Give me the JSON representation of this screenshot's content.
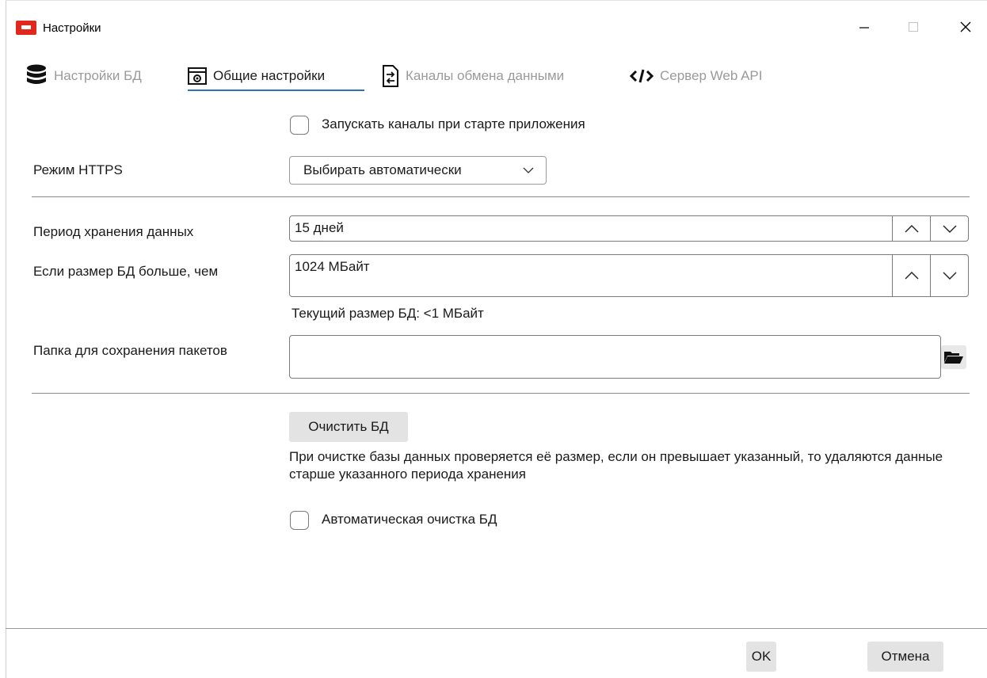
{
  "window": {
    "title": "Настройки"
  },
  "tabs": [
    {
      "label": "Настройки БД",
      "icon": "database-icon",
      "active": false
    },
    {
      "label": "Общие настройки",
      "icon": "settings-window-icon",
      "active": true
    },
    {
      "label": "Каналы обмена данными",
      "icon": "exchange-icon",
      "active": false
    },
    {
      "label": "Сервер Web API",
      "icon": "code-icon",
      "active": false
    }
  ],
  "form": {
    "start_channels_label": "Запускать каналы при старте приложения",
    "start_channels_checked": false,
    "https_mode_label": "Режим HTTPS",
    "https_mode_value": "Выбирать автоматически",
    "retention_label": "Период хранения данных",
    "retention_value": "15 дней",
    "db_size_label": "Если размер БД больше, чем",
    "db_size_value": "1024 МБайт",
    "current_db_size": "Текущий размер БД: <1 МБайт",
    "packets_folder_label": "Папка для сохранения пакетов",
    "packets_folder_value": "",
    "clear_db_button": "Очистить БД",
    "clear_description": "При очистке базы данных проверяется её размер, если он превышает указанный, то удаляются данные старше указанного периода хранения",
    "auto_clear_label": "Автоматическая очистка БД",
    "auto_clear_checked": false
  },
  "footer": {
    "ok_button": "OK",
    "cancel_button": "Отмена"
  },
  "colors": {
    "accent": "#2b73b8",
    "app_icon": "#e0281d"
  }
}
